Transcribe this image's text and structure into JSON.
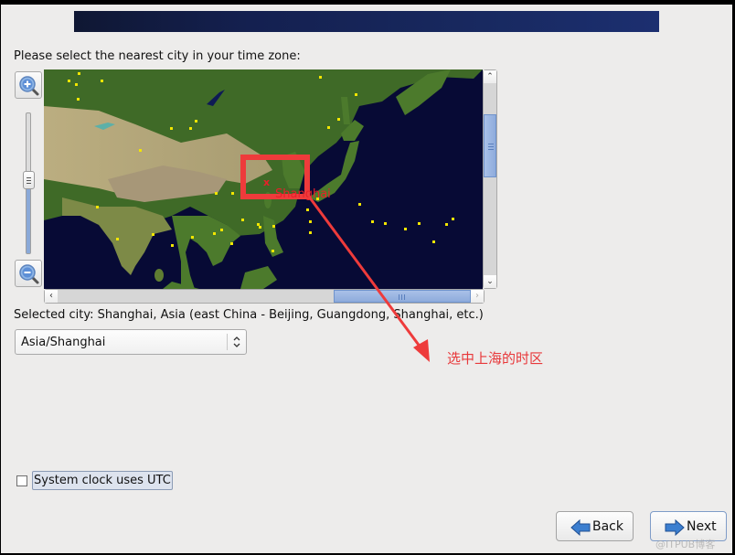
{
  "prompt": "Please select the nearest city in your time zone:",
  "map": {
    "selected_city_marker": "x",
    "selected_city_label": "Shanghai",
    "zoom_level_fraction": 0.48,
    "vertical_scroll_position": 0.35,
    "horizontal_scroll_position": 0.7,
    "colors": {
      "ocean": "#070a35",
      "city_dot": "#f2e600",
      "selected": "#e8202a"
    }
  },
  "selected_city_text": "Selected city: Shanghai, Asia (east China - Beijing, Guangdong, Shanghai, etc.)",
  "timezone_select": {
    "value": "Asia/Shanghai"
  },
  "annotation": {
    "text": "选中上海的时区",
    "color": "#e8383a"
  },
  "utc_checkbox": {
    "label": "System clock uses UTC",
    "checked": false
  },
  "buttons": {
    "back": "Back",
    "next": "Next"
  },
  "watermark": "@ITPUB博客"
}
